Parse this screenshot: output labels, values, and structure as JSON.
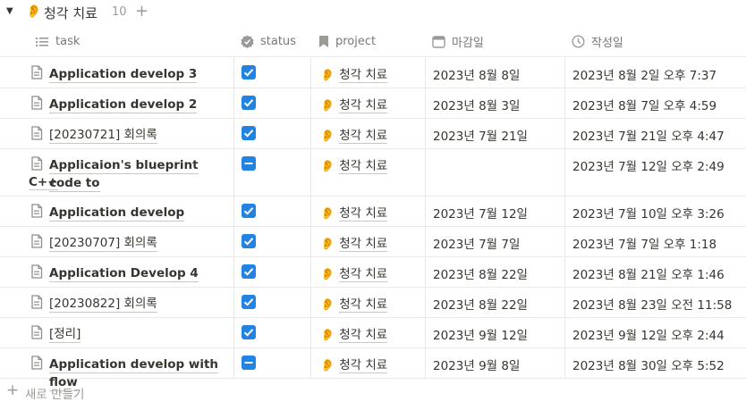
{
  "group": {
    "title": "청각 치료",
    "count": "10",
    "emoji": "👂"
  },
  "columns": {
    "task": "task",
    "status": "status",
    "project": "project",
    "due": "마감일",
    "created": "작성일"
  },
  "rows": [
    {
      "task": "Application develop 3",
      "status": "done",
      "project": "청각 치료",
      "due": "2023년 8월 8일",
      "created": "2023년 8월 2일 오후 7:37"
    },
    {
      "task": "Application develop 2",
      "status": "done",
      "project": "청각 치료",
      "due": "2023년 8월 3일",
      "created": "2023년 8월 7일 오후 4:59"
    },
    {
      "task": "[20230721] 회의록",
      "status": "done",
      "project": "청각 치료",
      "due": "2023년 7월 21일",
      "created": "2023년 7월 21일 오후 4:47"
    },
    {
      "task": "Applicaion's blueprint code to",
      "task_line2": "C++",
      "status": "partial",
      "project": "청각 치료",
      "due": "",
      "created": "2023년 7월 12일 오후 2:49"
    },
    {
      "task": "Application develop",
      "status": "done",
      "project": "청각 치료",
      "due": "2023년 7월 12일",
      "created": "2023년 7월 10일 오후 3:26"
    },
    {
      "task": "[20230707] 회의록",
      "status": "done",
      "project": "청각 치료",
      "due": "2023년 7월 7일",
      "created": "2023년 7월 7일 오후 1:18"
    },
    {
      "task": "Application Develop 4",
      "status": "done",
      "project": "청각 치료",
      "due": "2023년 8월 22일",
      "created": "2023년 8월 21일 오후 1:46"
    },
    {
      "task": "[20230822] 회의록",
      "status": "done",
      "project": "청각 치료",
      "due": "2023년 8월 22일",
      "created": "2023년 8월 23일 오전 11:58"
    },
    {
      "task": "[정리]",
      "status": "done",
      "project": "청각 치료",
      "due": "2023년 9월 12일",
      "created": "2023년 9월 12일 오후 2:44"
    },
    {
      "task": "Application develop with flow",
      "status": "partial",
      "project": "청각 치료",
      "due": "2023년 9월 8일",
      "created": "2023년 8월 30일 오후 5:52"
    }
  ],
  "new_row_label": "새로 만들기",
  "colors": {
    "accent": "#2383e2",
    "text": "#37352f",
    "muted": "#9b9a97",
    "border": "#e9e9e7"
  }
}
